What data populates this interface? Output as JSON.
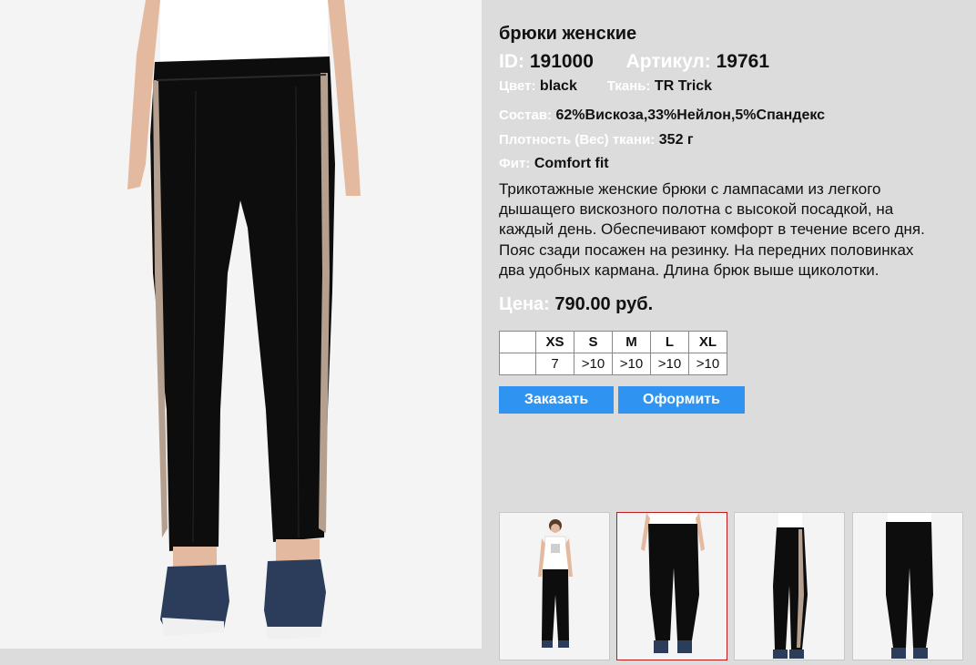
{
  "product": {
    "title": "брюки женские",
    "id_label": "ID:",
    "id_value": "191000",
    "article_label": "Артикул:",
    "article_value": "19761",
    "color_label": "Цвет:",
    "color_value": "black",
    "fabric_label": "Ткань:",
    "fabric_value": "TR Trick",
    "composition_label": "Состав:",
    "composition_value": "62%Вискоза,33%Нейлон,5%Спандекс",
    "density_label": "Плотность (Вес) ткани:",
    "density_value": "352 г",
    "fit_label": "Фит:",
    "fit_value": "Comfort fit",
    "description": "Трикотажные женские брюки с лампасами из легкого\nдышащего вискозного полотна с высокой посадкой, на\nкаждый день. Обеспечивают комфорт в течение всего дня.\nПояс сзади посажен на резинку.  На передних половинках\nдва удобных кармана. Длина брюк выше щиколотки.",
    "price_label": "Цена:",
    "price_value": "790.00 руб."
  },
  "sizes": {
    "headers": [
      "",
      "XS",
      "S",
      "M",
      "L",
      "XL"
    ],
    "stock": [
      "",
      "7",
      ">10",
      ">10",
      ">10",
      ">10"
    ]
  },
  "actions": {
    "order_label": "Заказать",
    "checkout_label": "Оформить"
  },
  "gallery": {
    "thumbnails": [
      "full-body-front-photo",
      "front-pants-photo",
      "side-pants-photo",
      "back-pants-photo"
    ],
    "selected_index": 1
  },
  "colors": {
    "background": "#dcdcdc",
    "label_white": "#ffffff",
    "button_blue": "#2f93f1",
    "selected_border": "#c0191a",
    "pants_black": "#0d0d0d",
    "stripe_beige": "#b59f8e",
    "shoe_navy": "#2c3d5c"
  }
}
